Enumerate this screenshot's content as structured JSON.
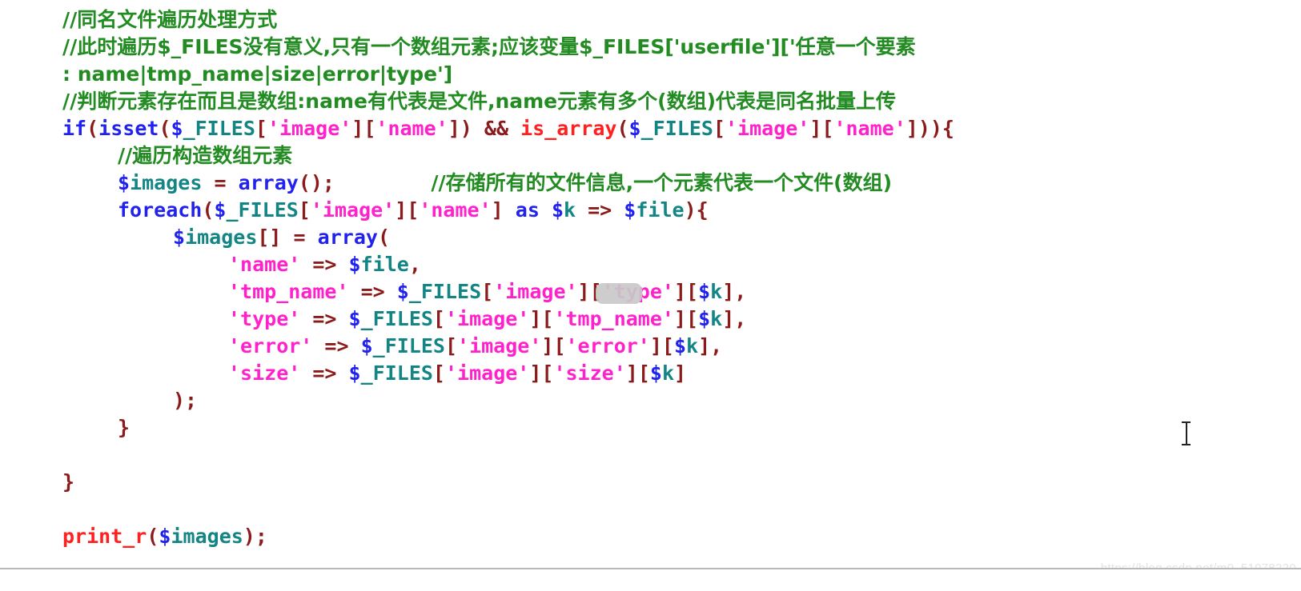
{
  "editor": {
    "language": "php",
    "background": "#ffffff",
    "colors": {
      "comment": "#228b22",
      "keyword": "#2222ee",
      "builtin_red": "#ff2020",
      "variable": "#138585",
      "sigil": "#2222ee",
      "string": "#ff22cc",
      "punctuation": "#8b1a1a"
    },
    "lines": [
      {
        "n": 1,
        "indent": 0,
        "tokens": [
          {
            "t": "comment",
            "v": "//同名文件遍历处理方式"
          }
        ]
      },
      {
        "n": 2,
        "indent": 0,
        "tokens": [
          {
            "t": "comment",
            "v": "//此时遍历"
          },
          {
            "t": "comment-mono",
            "v": "$_FILES"
          },
          {
            "t": "comment",
            "v": "没有意义,只有一个数组元素;应该变量"
          },
          {
            "t": "comment-mono",
            "v": "$_FILES['userfile']["
          },
          {
            "t": "comment",
            "v": "'任意一个要素"
          }
        ]
      },
      {
        "n": 3,
        "indent": 0,
        "tokens": [
          {
            "t": "comment-mono",
            "v": ": name|tmp_name|size|error|type']"
          }
        ]
      },
      {
        "n": 4,
        "indent": 0,
        "tokens": [
          {
            "t": "comment",
            "v": "//判断元素存在而且是数组:"
          },
          {
            "t": "comment-mono",
            "v": "name"
          },
          {
            "t": "comment",
            "v": "有代表是文件,"
          },
          {
            "t": "comment-mono",
            "v": "name"
          },
          {
            "t": "comment",
            "v": "元素有多个(数组)代表是同名批量上传"
          }
        ]
      },
      {
        "n": 5,
        "indent": 0,
        "tokens": [
          {
            "t": "keyword",
            "v": "if"
          },
          {
            "t": "punc",
            "v": "("
          },
          {
            "t": "keyword",
            "v": "isset"
          },
          {
            "t": "punc",
            "v": "("
          },
          {
            "t": "sigil",
            "v": "$"
          },
          {
            "t": "var",
            "v": "_FILES"
          },
          {
            "t": "punc",
            "v": "["
          },
          {
            "t": "string",
            "v": "'image'"
          },
          {
            "t": "punc",
            "v": "]["
          },
          {
            "t": "string",
            "v": "'name'"
          },
          {
            "t": "punc",
            "v": "])"
          },
          {
            "t": "plain",
            "v": " "
          },
          {
            "t": "punc",
            "v": "&&"
          },
          {
            "t": "plain",
            "v": " "
          },
          {
            "t": "func-red",
            "v": "is_array"
          },
          {
            "t": "punc",
            "v": "("
          },
          {
            "t": "sigil",
            "v": "$"
          },
          {
            "t": "var",
            "v": "_FILES"
          },
          {
            "t": "punc",
            "v": "["
          },
          {
            "t": "string",
            "v": "'image'"
          },
          {
            "t": "punc",
            "v": "]["
          },
          {
            "t": "string",
            "v": "'name'"
          },
          {
            "t": "punc",
            "v": "])){"
          }
        ]
      },
      {
        "n": 6,
        "indent": 1,
        "tokens": [
          {
            "t": "comment",
            "v": "//遍历构造数组元素"
          }
        ]
      },
      {
        "n": 7,
        "indent": 1,
        "tokens": [
          {
            "t": "sigil",
            "v": "$"
          },
          {
            "t": "var",
            "v": "images"
          },
          {
            "t": "plain",
            "v": " "
          },
          {
            "t": "punc",
            "v": "="
          },
          {
            "t": "plain",
            "v": " "
          },
          {
            "t": "keyword",
            "v": "array"
          },
          {
            "t": "punc",
            "v": "();"
          },
          {
            "t": "plain",
            "v": "        "
          },
          {
            "t": "comment",
            "v": "//存储所有的文件信息,一个元素代表一个文件(数组)"
          }
        ]
      },
      {
        "n": 8,
        "indent": 1,
        "tokens": [
          {
            "t": "keyword",
            "v": "foreach"
          },
          {
            "t": "punc",
            "v": "("
          },
          {
            "t": "sigil",
            "v": "$"
          },
          {
            "t": "var",
            "v": "_FILES"
          },
          {
            "t": "punc",
            "v": "["
          },
          {
            "t": "string",
            "v": "'image'"
          },
          {
            "t": "punc",
            "v": "]["
          },
          {
            "t": "string",
            "v": "'name'"
          },
          {
            "t": "punc",
            "v": "]"
          },
          {
            "t": "plain",
            "v": " "
          },
          {
            "t": "keyword",
            "v": "as"
          },
          {
            "t": "plain",
            "v": " "
          },
          {
            "t": "sigil",
            "v": "$"
          },
          {
            "t": "var",
            "v": "k"
          },
          {
            "t": "plain",
            "v": " "
          },
          {
            "t": "punc",
            "v": "=>"
          },
          {
            "t": "plain",
            "v": " "
          },
          {
            "t": "sigil",
            "v": "$"
          },
          {
            "t": "var",
            "v": "file"
          },
          {
            "t": "punc",
            "v": "){"
          }
        ]
      },
      {
        "n": 9,
        "indent": 2,
        "tokens": [
          {
            "t": "sigil",
            "v": "$"
          },
          {
            "t": "var",
            "v": "images"
          },
          {
            "t": "punc",
            "v": "[]"
          },
          {
            "t": "plain",
            "v": " "
          },
          {
            "t": "punc",
            "v": "="
          },
          {
            "t": "plain",
            "v": " "
          },
          {
            "t": "keyword",
            "v": "array"
          },
          {
            "t": "punc",
            "v": "("
          }
        ]
      },
      {
        "n": 10,
        "indent": 3,
        "tokens": [
          {
            "t": "string",
            "v": "'name'"
          },
          {
            "t": "plain",
            "v": " "
          },
          {
            "t": "punc",
            "v": "=>"
          },
          {
            "t": "plain",
            "v": " "
          },
          {
            "t": "sigil",
            "v": "$"
          },
          {
            "t": "var",
            "v": "file"
          },
          {
            "t": "punc",
            "v": ","
          }
        ]
      },
      {
        "n": 11,
        "indent": 3,
        "tokens": [
          {
            "t": "string",
            "v": "'tmp_name'"
          },
          {
            "t": "plain",
            "v": " "
          },
          {
            "t": "punc",
            "v": "=>"
          },
          {
            "t": "plain",
            "v": " "
          },
          {
            "t": "sigil",
            "v": "$"
          },
          {
            "t": "var",
            "v": "_FILES"
          },
          {
            "t": "punc",
            "v": "["
          },
          {
            "t": "string",
            "v": "'image'"
          },
          {
            "t": "punc",
            "v": "]["
          },
          {
            "t": "string",
            "v": "'type'"
          },
          {
            "t": "punc",
            "v": "]["
          },
          {
            "t": "sigil",
            "v": "$"
          },
          {
            "t": "var",
            "v": "k"
          },
          {
            "t": "punc",
            "v": "],"
          }
        ]
      },
      {
        "n": 12,
        "indent": 3,
        "tokens": [
          {
            "t": "string",
            "v": "'type'"
          },
          {
            "t": "plain",
            "v": " "
          },
          {
            "t": "punc",
            "v": "=>"
          },
          {
            "t": "plain",
            "v": " "
          },
          {
            "t": "sigil",
            "v": "$"
          },
          {
            "t": "var",
            "v": "_FILES"
          },
          {
            "t": "punc",
            "v": "["
          },
          {
            "t": "string",
            "v": "'image'"
          },
          {
            "t": "punc",
            "v": "]["
          },
          {
            "t": "string",
            "v": "'tmp_name'"
          },
          {
            "t": "punc",
            "v": "]["
          },
          {
            "t": "sigil",
            "v": "$"
          },
          {
            "t": "var",
            "v": "k"
          },
          {
            "t": "punc",
            "v": "],"
          }
        ]
      },
      {
        "n": 13,
        "indent": 3,
        "tokens": [
          {
            "t": "string",
            "v": "'error'"
          },
          {
            "t": "plain",
            "v": " "
          },
          {
            "t": "punc",
            "v": "=>"
          },
          {
            "t": "plain",
            "v": " "
          },
          {
            "t": "sigil",
            "v": "$"
          },
          {
            "t": "var",
            "v": "_FILES"
          },
          {
            "t": "punc",
            "v": "["
          },
          {
            "t": "string",
            "v": "'image'"
          },
          {
            "t": "punc",
            "v": "]["
          },
          {
            "t": "string",
            "v": "'error'"
          },
          {
            "t": "punc",
            "v": "]["
          },
          {
            "t": "sigil",
            "v": "$"
          },
          {
            "t": "var",
            "v": "k"
          },
          {
            "t": "punc",
            "v": "],"
          }
        ]
      },
      {
        "n": 14,
        "indent": 3,
        "tokens": [
          {
            "t": "string",
            "v": "'size'"
          },
          {
            "t": "plain",
            "v": " "
          },
          {
            "t": "punc",
            "v": "=>"
          },
          {
            "t": "plain",
            "v": " "
          },
          {
            "t": "sigil",
            "v": "$"
          },
          {
            "t": "var",
            "v": "_FILES"
          },
          {
            "t": "punc",
            "v": "["
          },
          {
            "t": "string",
            "v": "'image'"
          },
          {
            "t": "punc",
            "v": "]["
          },
          {
            "t": "string",
            "v": "'size'"
          },
          {
            "t": "punc",
            "v": "]["
          },
          {
            "t": "sigil",
            "v": "$"
          },
          {
            "t": "var",
            "v": "k"
          },
          {
            "t": "punc",
            "v": "]"
          }
        ]
      },
      {
        "n": 15,
        "indent": 2,
        "tokens": [
          {
            "t": "punc",
            "v": ");"
          }
        ]
      },
      {
        "n": 16,
        "indent": 1,
        "tokens": [
          {
            "t": "punc",
            "v": "}"
          }
        ]
      },
      {
        "n": 17,
        "indent": 0,
        "tokens": []
      },
      {
        "n": 18,
        "indent": 0,
        "tokens": [
          {
            "t": "punc",
            "v": "}"
          }
        ]
      },
      {
        "n": 19,
        "indent": 0,
        "tokens": []
      },
      {
        "n": 20,
        "indent": 0,
        "tokens": [
          {
            "t": "func-red",
            "v": "print_r"
          },
          {
            "t": "punc",
            "v": "("
          },
          {
            "t": "sigil",
            "v": "$"
          },
          {
            "t": "var",
            "v": "images"
          },
          {
            "t": "punc",
            "v": ");"
          }
        ]
      }
    ]
  },
  "overlays": {
    "hover_badge": {
      "label": "",
      "color": "#c9c9c9"
    },
    "text_caret": {
      "label": "text-cursor"
    },
    "watermark": {
      "text": "https://blog.csdn.net/m0_51078220"
    }
  }
}
